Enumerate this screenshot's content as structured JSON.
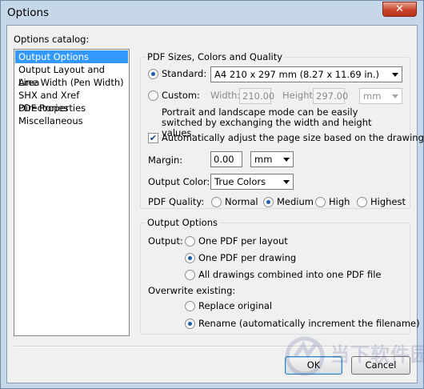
{
  "window": {
    "title": "Options",
    "close_glyph": "✕"
  },
  "catalog": {
    "label": "Options catalog:",
    "items": [
      "Output Options",
      "Output Layout and Area",
      "Line Width (Pen Width)",
      "SHX and Xref Directories",
      "PDF Properties",
      "Miscellaneous"
    ],
    "selected_index": 0
  },
  "pdf_group": {
    "title": "PDF Sizes, Colors and Quality",
    "standard_label": "Standard:",
    "standard_value": "A4 210 x 297 mm (8.27 x 11.69 in.)",
    "custom_label": "Custom:",
    "width_label": "Width:",
    "width_value": "210.00",
    "height_label": "Height:",
    "height_value": "297.00",
    "custom_unit": "mm",
    "note": "Portrait and landscape mode can be easily switched by exchanging the width and height values.",
    "auto_adjust_label": "Automatically adjust the page size based on the drawing",
    "auto_adjust_checked": true,
    "margin_label": "Margin:",
    "margin_value": "0.00",
    "margin_unit": "mm",
    "output_color_label": "Output Color:",
    "output_color_value": "True Colors",
    "quality_label": "PDF Quality:",
    "quality_options": [
      "Normal",
      "Medium",
      "High",
      "Highest"
    ],
    "quality_selected": "Medium",
    "size_mode": "Standard"
  },
  "output_group": {
    "title": "Output Options",
    "output_label": "Output:",
    "output_options": [
      "One PDF per layout",
      "One PDF per drawing",
      "All drawings combined into one PDF file"
    ],
    "output_selected": "One PDF per drawing",
    "overwrite_label": "Overwrite existing:",
    "overwrite_options": [
      "Replace original",
      "Rename (automatically increment the filename)"
    ],
    "overwrite_selected": "Rename (automatically increment the filename)"
  },
  "buttons": {
    "ok": "OK",
    "cancel": "Cancel"
  },
  "watermark": "当下软件园"
}
